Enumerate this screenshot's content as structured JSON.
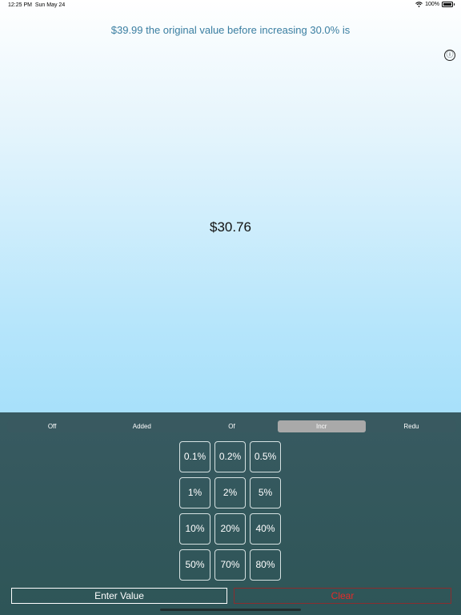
{
  "status": {
    "time": "12:25 PM",
    "date": "Sun May 24",
    "battery": "100%"
  },
  "headline": "$39.99 the original value before increasing 30.0% is",
  "result": "$30.76",
  "info_icon": "ⓘ",
  "modes": [
    "Off",
    "Added",
    "Of",
    "Incr",
    "Redu"
  ],
  "selected_mode": "Incr",
  "keys": [
    "0.1%",
    "0.2%",
    "0.5%",
    "1%",
    "2%",
    "5%",
    "10%",
    "20%",
    "40%",
    "50%",
    "70%",
    "80%"
  ],
  "buttons": {
    "enter": "Enter Value",
    "clear": "Clear"
  },
  "colors": {
    "headline": "#3a7ea1",
    "panel": "#2e5557",
    "selected_segment": "#a9a9a9",
    "clear_text": "#e52b28"
  }
}
